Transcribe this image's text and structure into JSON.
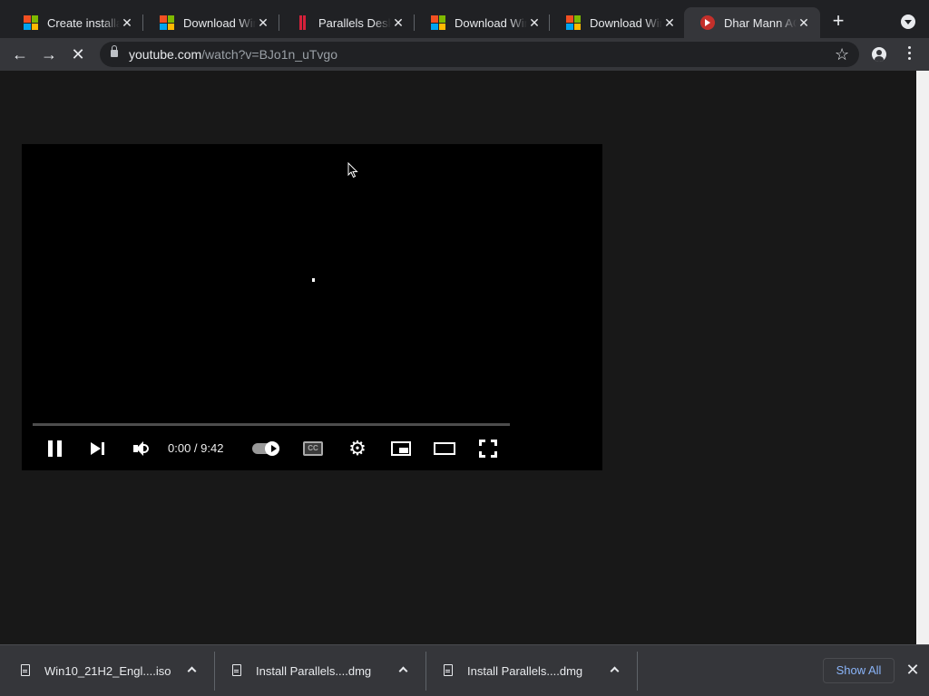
{
  "tabs": [
    {
      "title": "Create installat",
      "favicon": "microsoft-logo",
      "close": "✕"
    },
    {
      "title": "Download Wind",
      "favicon": "microsoft-logo",
      "close": "✕"
    },
    {
      "title": "Parallels Deskt",
      "favicon": "parallels-logo",
      "close": "✕"
    },
    {
      "title": "Download Wind",
      "favicon": "microsoft-logo",
      "close": "✕"
    },
    {
      "title": "Download Wind",
      "favicon": "microsoft-logo",
      "close": "✕"
    },
    {
      "title": "Dhar Mann ACT",
      "favicon": "youtube-logo",
      "close": "✕",
      "active": true
    }
  ],
  "toolbar": {
    "back": "←",
    "forward": "→",
    "stop": "✕",
    "new_tab": "+",
    "bookmark_star": "☆",
    "url_host": "youtube.com",
    "url_path": "/watch?v=BJo1n_uTvgo"
  },
  "player": {
    "time": "0:00 / 9:42",
    "cc_label": "CC",
    "settings_glyph": "⚙",
    "progress_fraction": 0
  },
  "downloads": {
    "items": [
      {
        "name": "Win10_21H2_Engl....iso"
      },
      {
        "name": "Install Parallels....dmg"
      },
      {
        "name": "Install Parallels....dmg"
      }
    ],
    "show_all": "Show All",
    "close": "✕"
  },
  "colors": {
    "tab_strip": "#202124",
    "toolbar": "#35363a",
    "page_bg": "#181818",
    "link_blue": "#8ab4f8"
  }
}
